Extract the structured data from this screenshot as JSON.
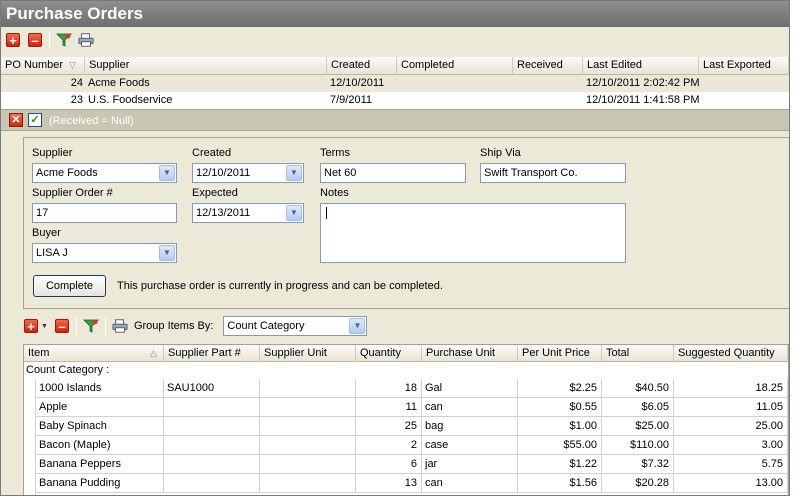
{
  "window": {
    "title": "Purchase Orders"
  },
  "toolbar_top": {
    "items": [
      "add-icon",
      "delete-icon",
      "filter-icon",
      "print-icon"
    ]
  },
  "po_grid": {
    "columns": [
      "PO Number",
      "Supplier",
      "Created",
      "Completed",
      "Received",
      "Last Edited",
      "Last Exported"
    ],
    "rows": [
      {
        "po": "24",
        "supplier": "Acme Foods",
        "created": "12/10/2011",
        "completed": "",
        "received": "",
        "last_edited": "12/10/2011 2:02:42 PM",
        "last_exported": ""
      },
      {
        "po": "23",
        "supplier": "U.S. Foodservice",
        "created": "7/9/2011",
        "completed": "",
        "received": "",
        "last_edited": "12/10/2011 1:41:58 PM",
        "last_exported": ""
      }
    ]
  },
  "filter_bar": {
    "text": "(Received = Null)"
  },
  "form": {
    "supplier_label": "Supplier",
    "supplier_value": "Acme Foods",
    "created_label": "Created",
    "created_value": "12/10/2011",
    "terms_label": "Terms",
    "terms_value": "Net 60",
    "ship_via_label": "Ship Via",
    "ship_via_value": "Swift Transport Co.",
    "supplier_order_label": "Supplier Order #",
    "supplier_order_value": "17",
    "expected_label": "Expected",
    "expected_value": "12/13/2011",
    "notes_label": "Notes",
    "notes_value": "",
    "buyer_label": "Buyer",
    "buyer_value": "LISA J",
    "complete_button": "Complete",
    "status_message": "This purchase order is currently in progress and can be completed."
  },
  "toolbar_items": {
    "group_label": "Group Items By:",
    "group_value": "Count Category"
  },
  "items_grid": {
    "columns": [
      "Item",
      "Supplier Part #",
      "Supplier Unit",
      "Quantity",
      "Purchase Unit",
      "Per Unit Price",
      "Total",
      "Suggested Quantity"
    ],
    "group_label": "Count Category :",
    "rows": [
      {
        "item": "1000 Islands",
        "part": "SAU1000",
        "unit": "",
        "qty": "18",
        "purchase_unit": "Gal",
        "price": "$2.25",
        "total": "$40.50",
        "suggested": "18.25"
      },
      {
        "item": "Apple",
        "part": "",
        "unit": "",
        "qty": "11",
        "purchase_unit": "can",
        "price": "$0.55",
        "total": "$6.05",
        "suggested": "11.05"
      },
      {
        "item": "Baby Spinach",
        "part": "",
        "unit": "",
        "qty": "25",
        "purchase_unit": "bag",
        "price": "$1.00",
        "total": "$25.00",
        "suggested": "25.00"
      },
      {
        "item": "Bacon (Maple)",
        "part": "",
        "unit": "",
        "qty": "2",
        "purchase_unit": "case",
        "price": "$55.00",
        "total": "$110.00",
        "suggested": "3.00"
      },
      {
        "item": "Banana Peppers",
        "part": "",
        "unit": "",
        "qty": "6",
        "purchase_unit": "jar",
        "price": "$1.22",
        "total": "$7.32",
        "suggested": "5.75"
      },
      {
        "item": "Banana Pudding",
        "part": "",
        "unit": "",
        "qty": "13",
        "purchase_unit": "can",
        "price": "$1.56",
        "total": "$20.28",
        "suggested": "13.00"
      }
    ]
  }
}
